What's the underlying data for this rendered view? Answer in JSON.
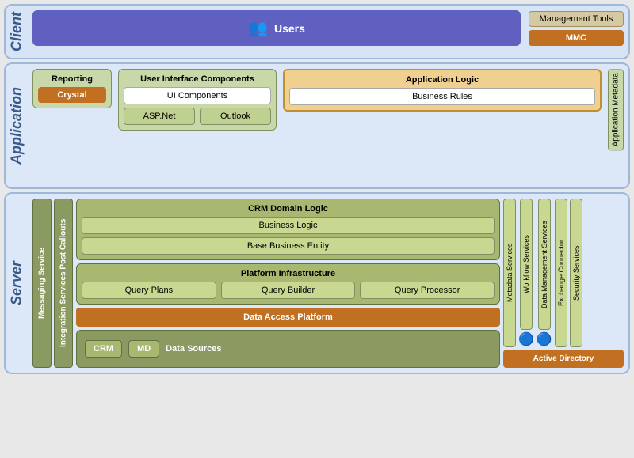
{
  "client": {
    "label": "Client",
    "users": {
      "label": "Users",
      "icon": "👥"
    },
    "management_tools": {
      "label": "Management Tools",
      "mmc": "MMC"
    }
  },
  "application": {
    "label": "Application",
    "reporting": {
      "label": "Reporting",
      "crystal": "Crystal"
    },
    "ui_components": {
      "label": "User Interface Components",
      "ui_components": "UI Components",
      "asp_net": "ASP.Net",
      "outlook": "Outlook"
    },
    "app_logic": {
      "title": "Application Logic",
      "business_rules": "Business Rules"
    },
    "app_metadata": "Application Metadata"
  },
  "server": {
    "label": "Server",
    "messaging": "Messaging Service",
    "integration": "Integration Services Post Callouts",
    "crm_domain": {
      "title": "CRM Domain Logic",
      "business_logic": "Business Logic",
      "base_business": "Base Business Entity"
    },
    "platform": {
      "title": "Platform Infrastructure",
      "query_plans": "Query Plans",
      "query_builder": "Query Builder",
      "query_processor": "Query Processor"
    },
    "metadata_services": "Metadata Services",
    "workflow_services": "Workflow Services",
    "data_mgmt": "Data Management Services",
    "exchange": "Exchange Connector",
    "security": "Security Services",
    "data_access": "Data Access Platform",
    "data_sources": {
      "label": "Data Sources",
      "crm": "CRM",
      "md": "MD"
    },
    "active_directory": "Active Directory"
  }
}
